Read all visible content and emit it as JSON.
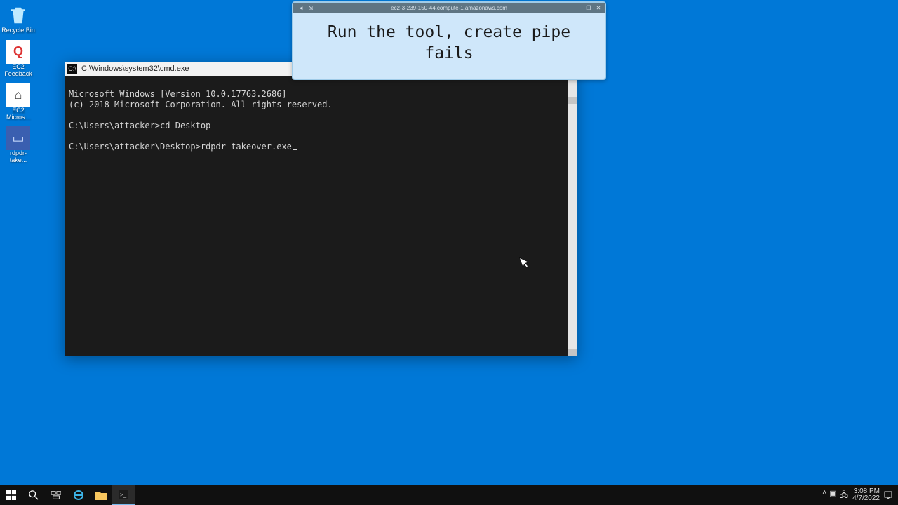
{
  "desktop": {
    "icons": [
      {
        "name": "recycle-bin",
        "label": "Recycle Bin",
        "glyph": "🗑"
      },
      {
        "name": "ec2-feedback",
        "label": "EC2 Feedback",
        "glyph": "Q"
      },
      {
        "name": "ec2-microsoft",
        "label": "EC2 Micros...",
        "glyph": "⌂"
      },
      {
        "name": "rdpdr-take",
        "label": "rdpdr-take...",
        "glyph": "▭"
      }
    ]
  },
  "cmd": {
    "title": "C:\\Windows\\system32\\cmd.exe",
    "lines": {
      "ver": "Microsoft Windows [Version 10.0.17763.2686]",
      "copy": "(c) 2018 Microsoft Corporation. All rights reserved.",
      "blank1": "",
      "p1": "C:\\Users\\attacker>cd Desktop",
      "blank2": "",
      "p2": "C:\\Users\\attacker\\Desktop>rdpdr-takeover.exe"
    }
  },
  "overlay": {
    "rdp_host": "ec2-3-239-150-44.compute-1.amazonaws.com",
    "caption": "Run the tool, create pipe fails"
  },
  "taskbar": {
    "time": "3:08 PM",
    "date": "4/7/2022"
  }
}
